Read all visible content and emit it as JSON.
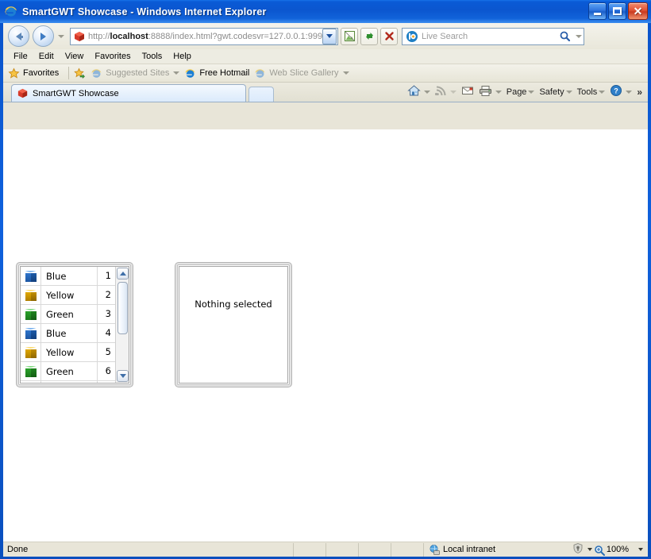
{
  "window": {
    "title": "SmartGWT Showcase - Windows Internet Explorer",
    "icon": "ie-logo-icon",
    "minimize_label": "Minimize",
    "maximize_label": "Maximize",
    "close_label": "Close"
  },
  "navigation": {
    "back_label": "Back",
    "forward_label": "Forward",
    "recent_pages_label": "Recent Pages",
    "address": {
      "scheme": "http://",
      "host": "localhost",
      "rest": ":8888/index.html?gwt.codesvr=127.0.0.1:999",
      "full": "http://localhost:8888/index.html?gwt.codesvr=127.0.0.1:999",
      "site_icon": "red-package-icon",
      "dropdown_label": "Address dropdown"
    },
    "compat_view_label": "Compatibility View",
    "refresh_label": "Refresh",
    "stop_label": "Stop"
  },
  "search": {
    "provider_icon": "bing-icon",
    "placeholder": "Live Search",
    "value": "",
    "go_label": "Search",
    "dropdown_label": "Search options"
  },
  "menubar": {
    "items": [
      {
        "label": "File"
      },
      {
        "label": "Edit"
      },
      {
        "label": "View"
      },
      {
        "label": "Favorites"
      },
      {
        "label": "Tools"
      },
      {
        "label": "Help"
      }
    ]
  },
  "favorites_bar": {
    "favorites_label": "Favorites",
    "add_label": "Add to Favorites Bar",
    "items": [
      {
        "label": "Suggested Sites",
        "icon": "ie-icon",
        "has_caret": true,
        "dim": true
      },
      {
        "label": "Free Hotmail",
        "icon": "ie-icon",
        "has_caret": false,
        "dim": false
      },
      {
        "label": "Web Slice Gallery",
        "icon": "ie-icon",
        "has_caret": true,
        "dim": true
      }
    ]
  },
  "tabs": {
    "active": {
      "label": "SmartGWT Showcase",
      "icon": "red-package-icon"
    },
    "new_tab_label": "New Tab"
  },
  "command_bar": {
    "items": [
      {
        "label": "",
        "icon": "home-icon",
        "has_caret": true
      },
      {
        "label": "",
        "icon": "feeds-icon",
        "has_caret": true
      },
      {
        "label": "",
        "icon": "mail-icon",
        "has_caret": false
      },
      {
        "label": "",
        "icon": "print-icon",
        "has_caret": true
      },
      {
        "label": "Page",
        "icon": "",
        "has_caret": true
      },
      {
        "label": "Safety",
        "icon": "",
        "has_caret": true
      },
      {
        "label": "Tools",
        "icon": "",
        "has_caret": true
      },
      {
        "label": "",
        "icon": "help-icon",
        "has_caret": true
      }
    ],
    "overflow_label": "»"
  },
  "page": {
    "listgrid": {
      "columns": [
        {
          "name": "icon",
          "label": ""
        },
        {
          "name": "name",
          "label": ""
        },
        {
          "name": "number",
          "label": ""
        }
      ],
      "rows": [
        {
          "icon": "cube-icon",
          "color_name": "Blue",
          "color": "#2e74cc",
          "number": "1"
        },
        {
          "icon": "cube-icon",
          "color_name": "Yellow",
          "color": "#e0a800",
          "number": "2"
        },
        {
          "icon": "cube-icon",
          "color_name": "Green",
          "color": "#2aa22a",
          "number": "3"
        },
        {
          "icon": "cube-icon",
          "color_name": "Blue",
          "color": "#2e74cc",
          "number": "4"
        },
        {
          "icon": "cube-icon",
          "color_name": "Yellow",
          "color": "#e0a800",
          "number": "5"
        },
        {
          "icon": "cube-icon",
          "color_name": "Green",
          "color": "#2aa22a",
          "number": "6"
        }
      ],
      "scrollbar": {
        "up_label": "Scroll up",
        "down_label": "Scroll down",
        "thumb_label": "Scroll thumb"
      }
    },
    "detail_panel": {
      "message": "Nothing selected"
    }
  },
  "statusbar": {
    "status": "Done",
    "zone": {
      "label": "Local intranet",
      "icon": "globe-icon"
    },
    "protected_mode": {
      "icon": "protected-mode-icon",
      "has_caret": true
    },
    "zoom": {
      "icon": "zoom-icon",
      "level": "100%",
      "has_caret": true
    }
  },
  "colors": {
    "title_blue": "#0b56cf",
    "chrome_beige": "#e8e5d8",
    "page_white": "#ffffff",
    "grid_border": "#a6a6a6"
  }
}
